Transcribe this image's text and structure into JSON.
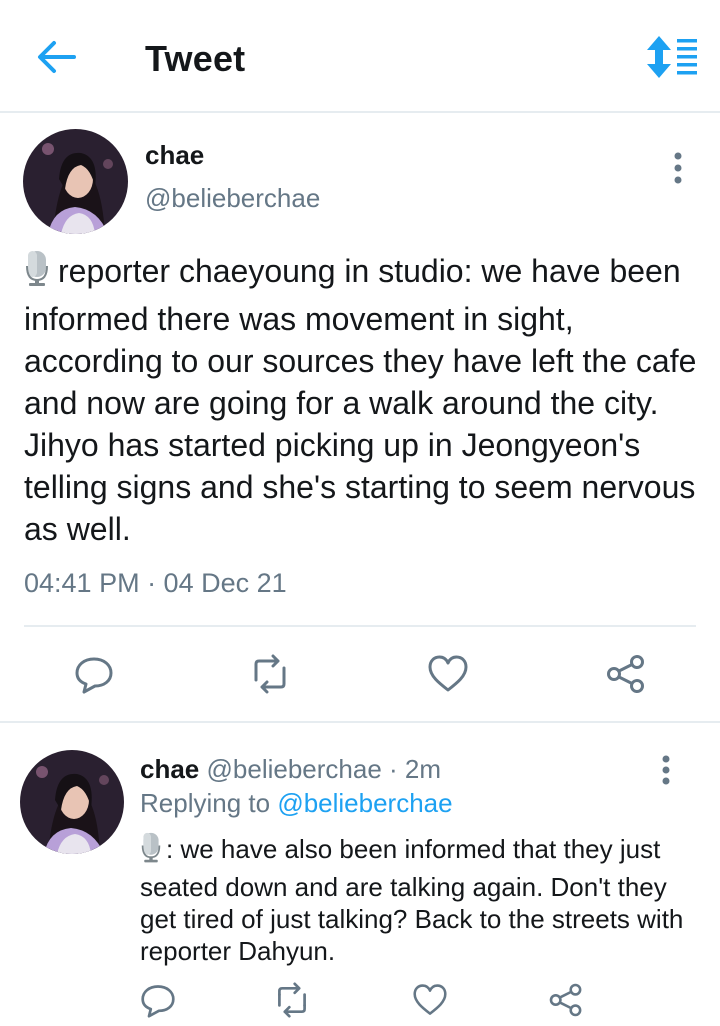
{
  "header": {
    "title": "Tweet",
    "back_icon": "arrow-left-icon",
    "sort_icon": "sort-icon",
    "accent_color": "#1da1f2"
  },
  "main_tweet": {
    "author_name": "chae",
    "author_handle": "@belieberchae",
    "text": "reporter chaeyoung in studio: we have been informed there was movement in sight, according to our sources they have left the cafe and now are going for a walk around the city. Jihyo has started picking up in Jeongyeon's telling signs and she's starting to seem nervous as well.",
    "emoji": "microphone-icon",
    "timestamp": "04:41 PM · 04 Dec 21"
  },
  "reply_tweet": {
    "author_name": "chae",
    "meta": "@belieberchae · 2m",
    "replying_to_label": "Replying to",
    "replying_to_handle": "@belieberchae",
    "text": ": we have also been informed that they just seated down and are talking again. Don't they get tired of just talking? Back to the streets with reporter Dahyun.",
    "emoji": "microphone-icon"
  },
  "actions": [
    "reply-icon",
    "retweet-icon",
    "like-icon",
    "share-icon"
  ],
  "colors": {
    "text": "#14171a",
    "secondary": "#657786",
    "divider": "#e6ecf0",
    "icon": "#657786"
  }
}
